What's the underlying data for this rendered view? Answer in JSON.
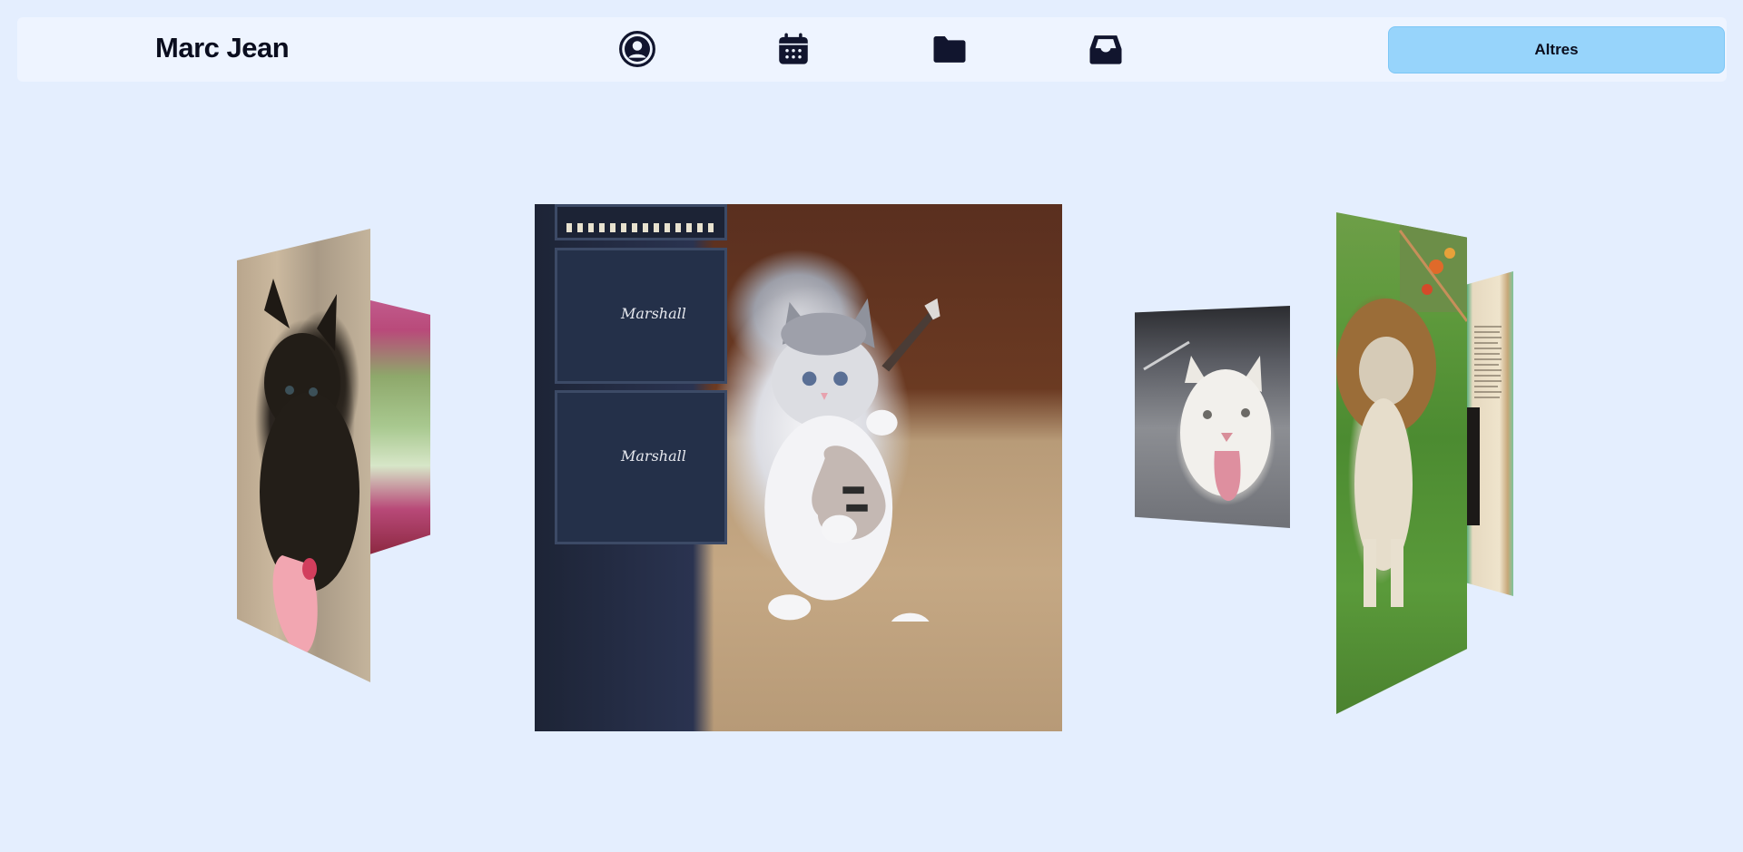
{
  "header": {
    "brand": "Marc Jean",
    "nav": [
      {
        "icon": "user-circle-icon"
      },
      {
        "icon": "calendar-icon"
      },
      {
        "icon": "folder-icon"
      },
      {
        "icon": "inbox-icon"
      }
    ],
    "action_label": "Altres"
  },
  "carousel": {
    "slides": [
      {
        "subject": "black-kitten"
      },
      {
        "subject": "pink-food-plate"
      },
      {
        "subject": "kitten-with-guitar"
      },
      {
        "subject": "cat-sticking-tongue-out"
      },
      {
        "subject": "cat-with-lion-mane"
      },
      {
        "subject": "open-book"
      }
    ],
    "amp_brand": "Marshall"
  },
  "colors": {
    "background": "#e4eefe",
    "topbar": "#eef4ff",
    "button": "#97d4fb",
    "icon": "#11152e"
  }
}
